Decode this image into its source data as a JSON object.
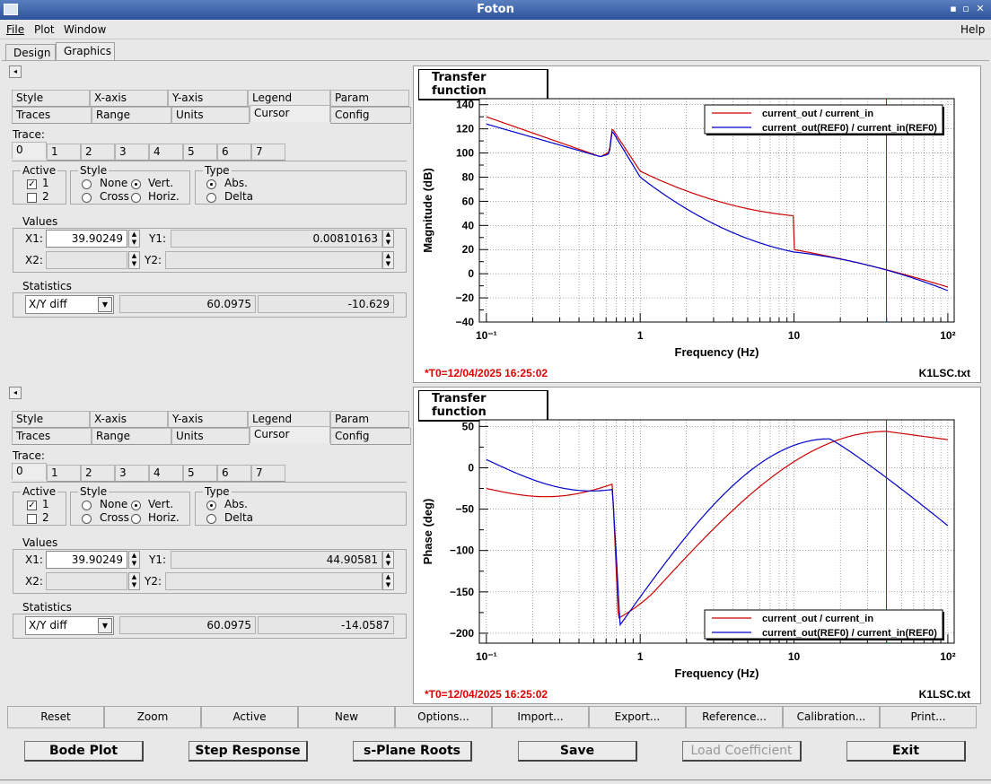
{
  "window": {
    "title": "Foton",
    "min_glyph": "▪",
    "max_glyph": "▫",
    "close_glyph": "✕"
  },
  "menu": {
    "file": "File",
    "plot": "Plot",
    "window": "Window",
    "help": "Help"
  },
  "main_tabs": [
    "Design",
    "Graphics"
  ],
  "panel_tabs": {
    "row1": [
      "Style",
      "X-axis",
      "Y-axis",
      "Legend",
      "Param"
    ],
    "row2": [
      "Traces",
      "Range",
      "Units",
      "Cursor",
      "Config"
    ]
  },
  "trace_label": "Trace:",
  "trace_tabs": [
    "0",
    "1",
    "2",
    "3",
    "4",
    "5",
    "6",
    "7"
  ],
  "labels": {
    "active": "Active",
    "style": "Style",
    "type": "Type",
    "values": "Values",
    "statistics": "Statistics",
    "cb1": "1",
    "cb2": "2",
    "none": "None",
    "vert": "Vert.",
    "cross": "Cross",
    "horiz": "Horiz.",
    "abs": "Abs.",
    "delta": "Delta",
    "x1": "X1:",
    "y1": "Y1:",
    "x2": "X2:",
    "y2": "Y2:",
    "expand": "◂"
  },
  "panels": [
    {
      "x1": "39.90249",
      "y1": "0.00810163",
      "stat_mode": "X/Y diff",
      "stat_x": "60.0975",
      "stat_y": "-10.629"
    },
    {
      "x1": "39.90249",
      "y1": "44.90581",
      "stat_mode": "X/Y diff",
      "stat_x": "60.0975",
      "stat_y": "-14.0587"
    }
  ],
  "plots": [
    {
      "title": "Transfer function",
      "ylabel": "Magnitude (dB)",
      "xlabel": "Frequency (Hz)",
      "yticks": [
        "140",
        "120",
        "100",
        "80",
        "60",
        "40",
        "20",
        "0",
        "−20",
        "−40"
      ],
      "xticks": [
        "10⁻¹",
        "1",
        "10",
        "10²"
      ],
      "legend": [
        "current_out / current_in",
        "current_out(REF0) / current_in(REF0)"
      ],
      "t0": "*T0=12/04/2025 16:25:02",
      "file": "K1LSC.txt"
    },
    {
      "title": "Transfer function",
      "ylabel": "Phase (deg)",
      "xlabel": "Frequency (Hz)",
      "yticks": [
        "50",
        "0",
        "−50",
        "−100",
        "−150",
        "−200"
      ],
      "xticks": [
        "10⁻¹",
        "1",
        "10",
        "10²"
      ],
      "legend": [
        "current_out / current_in",
        "current_out(REF0) / current_in(REF0)"
      ],
      "t0": "*T0=12/04/2025 16:25:02",
      "file": "K1LSC.txt"
    }
  ],
  "action_buttons": [
    "Reset",
    "Zoom",
    "Active",
    "New",
    "Options...",
    "Import...",
    "Export...",
    "Reference...",
    "Calibration...",
    "Print..."
  ],
  "bottom_buttons": [
    "Bode Plot",
    "Step Response",
    "s-Plane Roots",
    "Save",
    "Load Coefficient",
    "Exit"
  ],
  "colors": {
    "trace": "#cc0000",
    "ref": "#0000cc",
    "cursor": "#cc0000",
    "title_red": "#e00000"
  }
}
